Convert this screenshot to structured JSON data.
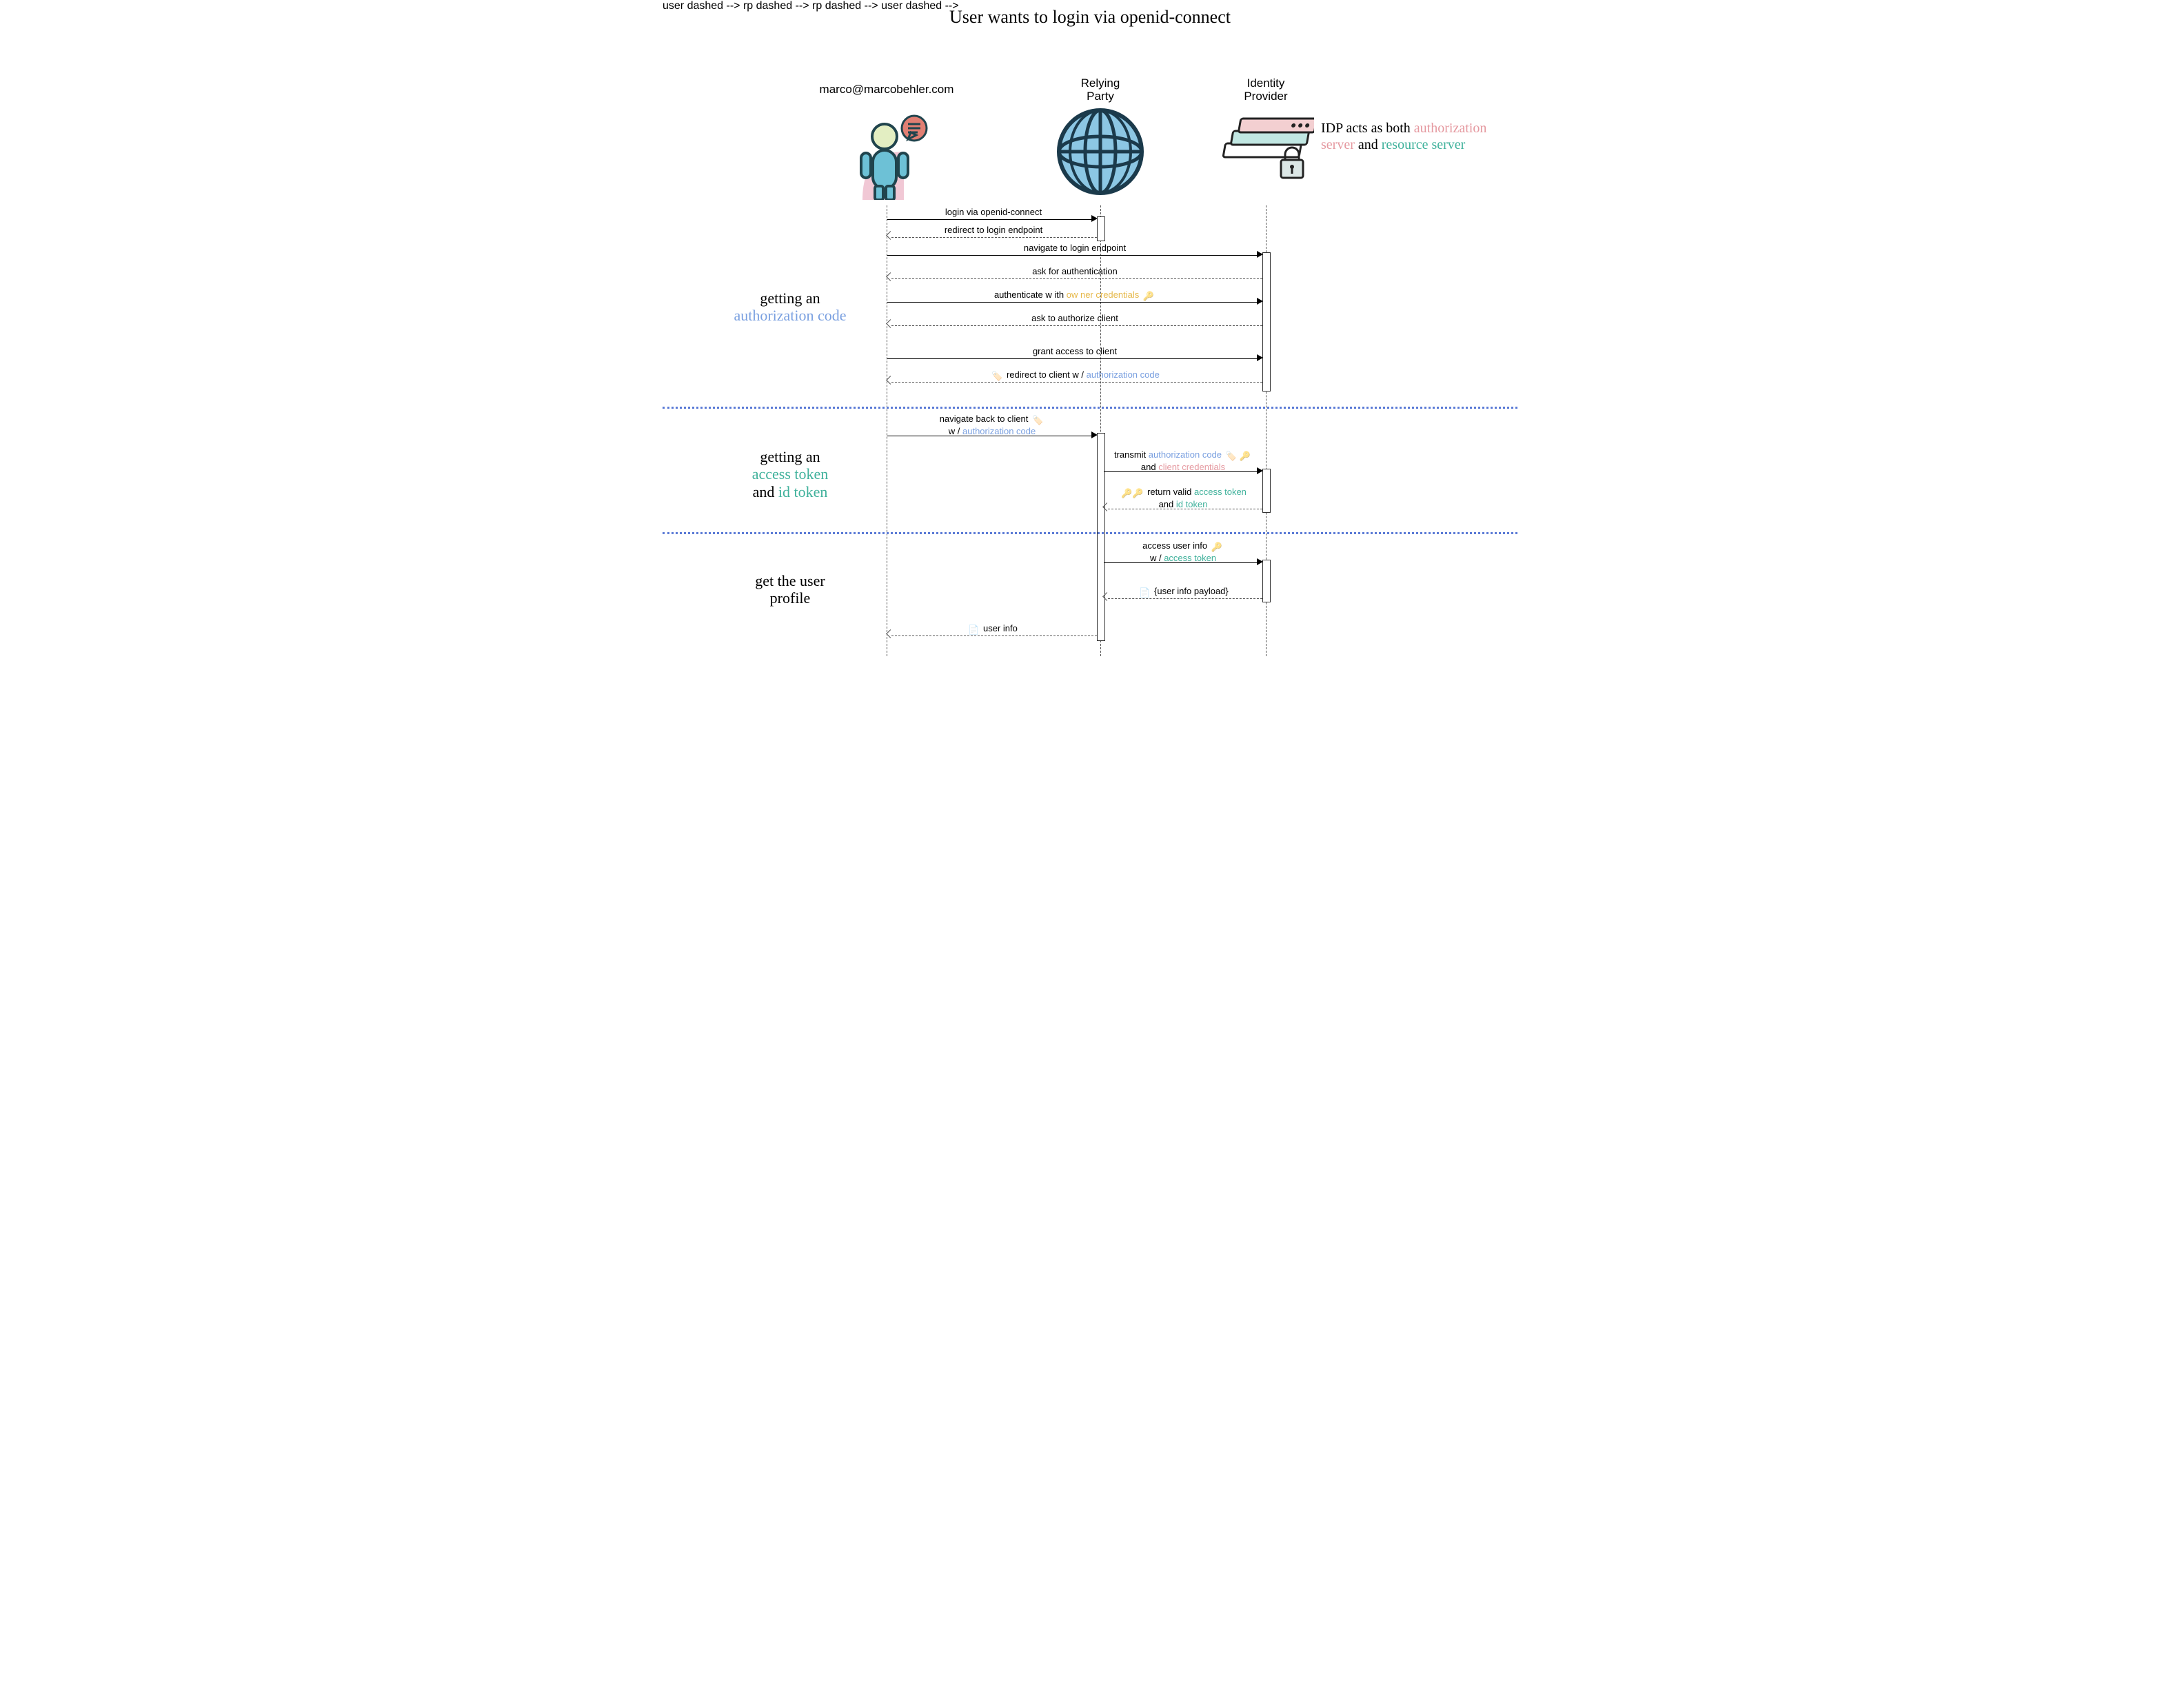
{
  "title": "User wants to login via openid-connect",
  "actors": {
    "user": "marco@marcobehler.com",
    "rp_line1": "Relying",
    "rp_line2": "Party",
    "idp_line1": "Identity",
    "idp_line2": "Provider"
  },
  "idp_note": {
    "pre": "IDP acts as both",
    "auth": "authorization server",
    "and": "and",
    "res": "resource server"
  },
  "sections": {
    "s1_a": "getting an",
    "s1_b": "authorization code",
    "s2_a": "getting an",
    "s2_b": "access token",
    "s2_c": "and",
    "s2_d": "id token",
    "s3_a": "get the user",
    "s3_b": "profile"
  },
  "msgs": {
    "m1": "login via openid-connect",
    "m2": "redirect to login endpoint",
    "m3": "navigate to login endpoint",
    "m4": "ask for authentication",
    "m5a": "authenticate w ith ",
    "m5b": "ow ner credentials",
    "m6": "ask to authorize client",
    "m7": "grant access to client",
    "m8a": "redirect to client w /",
    "m8b": "authorization code",
    "m9a": "navigate back to client",
    "m9b": "w /",
    "m9c": "authorization code",
    "m10a": "transmit",
    "m10b": "authorization code",
    "m10c": "and",
    "m10d": "client credentials",
    "m11a": "return valid",
    "m11b": "access token",
    "m11c": "and",
    "m11d": "id token",
    "m12a": "access user info",
    "m12b": "w /",
    "m12c": "access token",
    "m13": "{user info payload}",
    "m14": "user info"
  }
}
